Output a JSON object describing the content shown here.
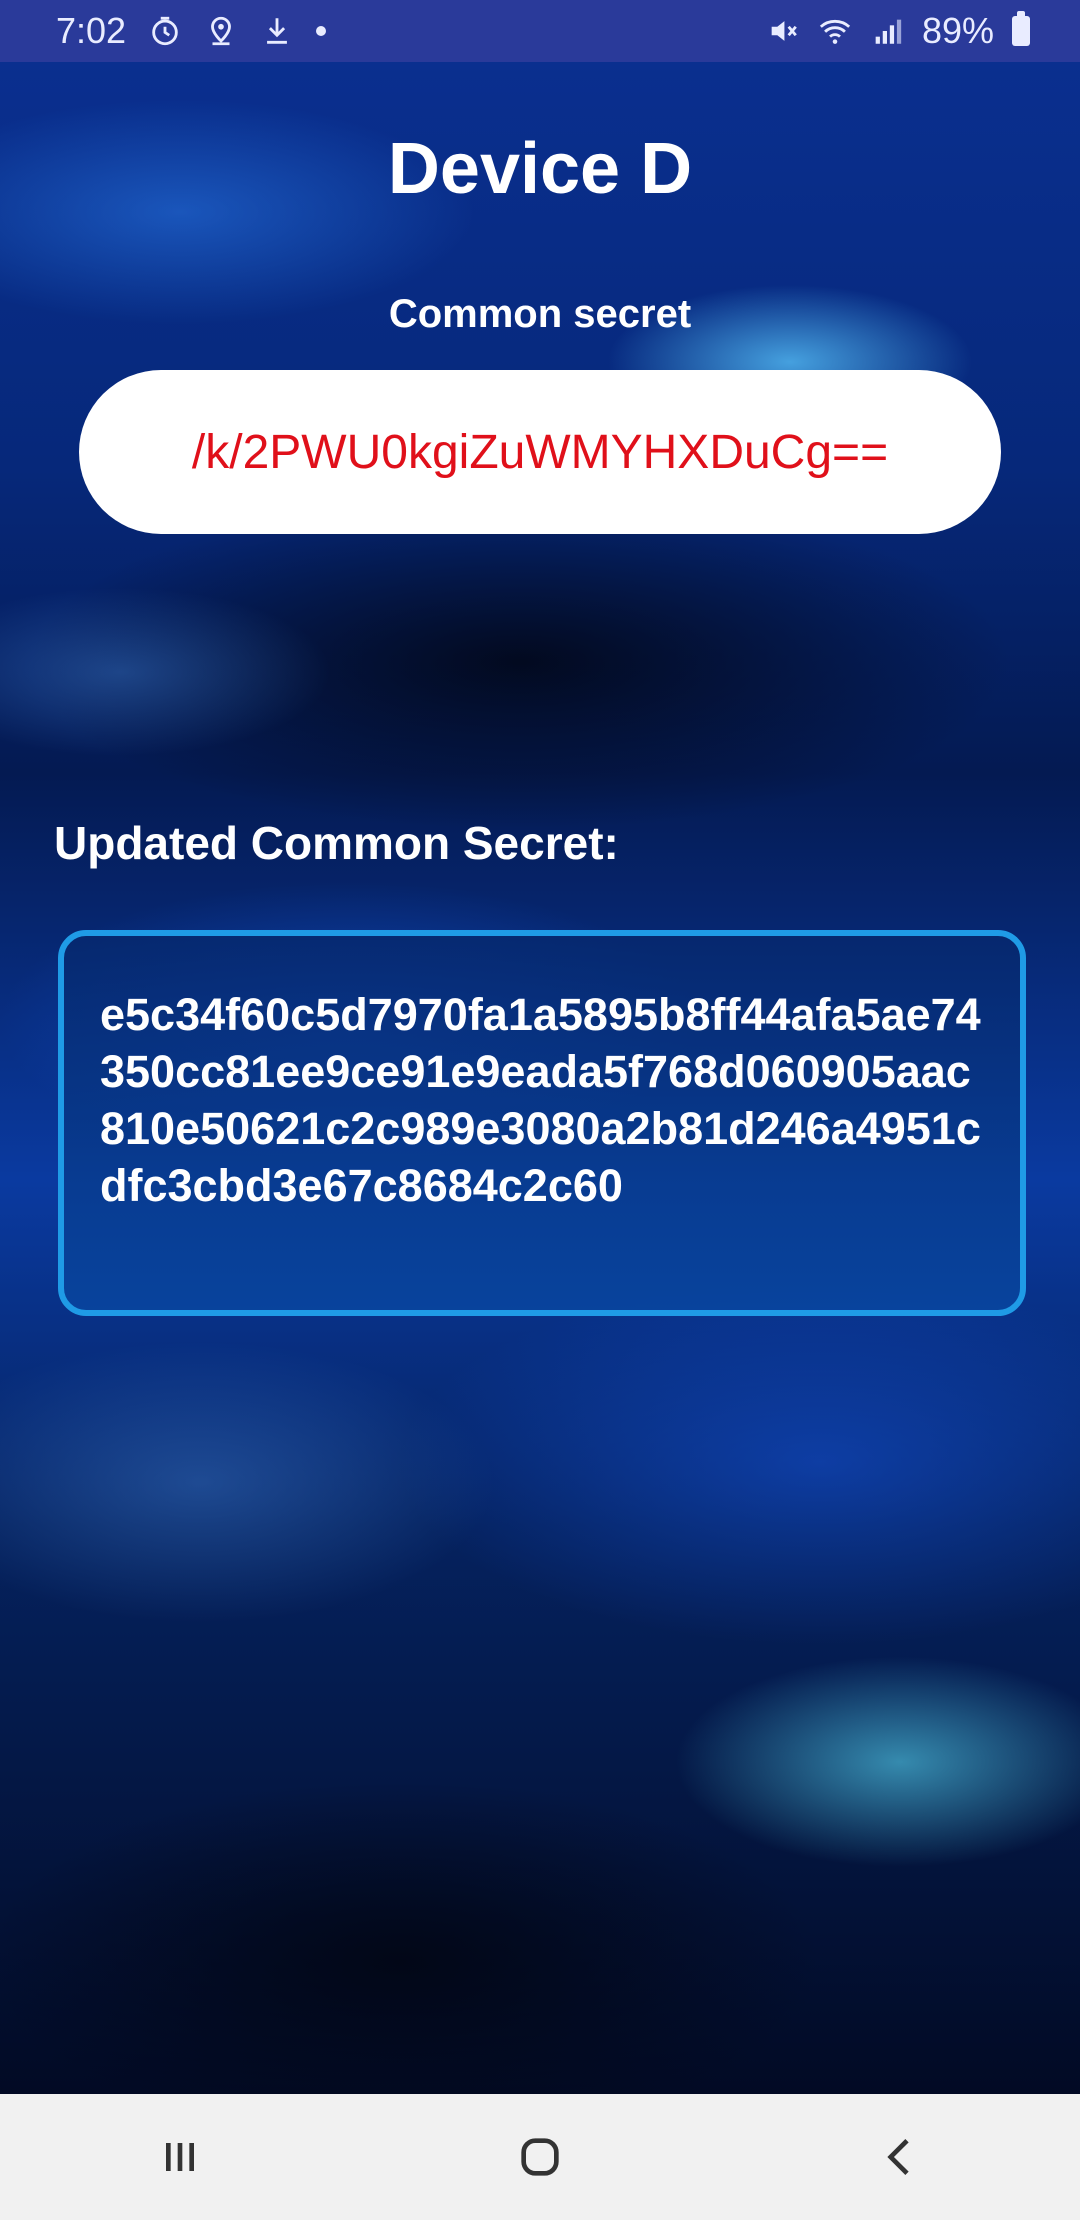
{
  "status_bar": {
    "time": "7:02",
    "battery": "89%",
    "left_icons": [
      "timer-icon",
      "location-icon",
      "download-icon",
      "dot-icon"
    ],
    "right_icons": [
      "mute-icon",
      "wifi-icon",
      "signal-icon",
      "battery-icon"
    ]
  },
  "screen": {
    "title": "Device D",
    "common_secret_label": "Common secret",
    "common_secret_value": "/k/2PWU0kgiZuWMYHXDuCg==",
    "updated_label": "Updated Common Secret:",
    "updated_value": "e5c34f60c5d7970fa1a5895b8ff44afa5ae74350cc81ee9ce91e9eada5f768d060905aac810e50621c2c989e3080a2b81d246a4951cdfc3cbd3e67c8684c2c60"
  },
  "nav_bar": {
    "buttons": [
      "recents-icon",
      "home-icon",
      "back-icon"
    ]
  },
  "colors": {
    "status_bar_bg": "#2a3a9a",
    "secret_text": "#e0101a",
    "box_border": "#1f9be6",
    "nav_bg": "#f1f1f1"
  }
}
